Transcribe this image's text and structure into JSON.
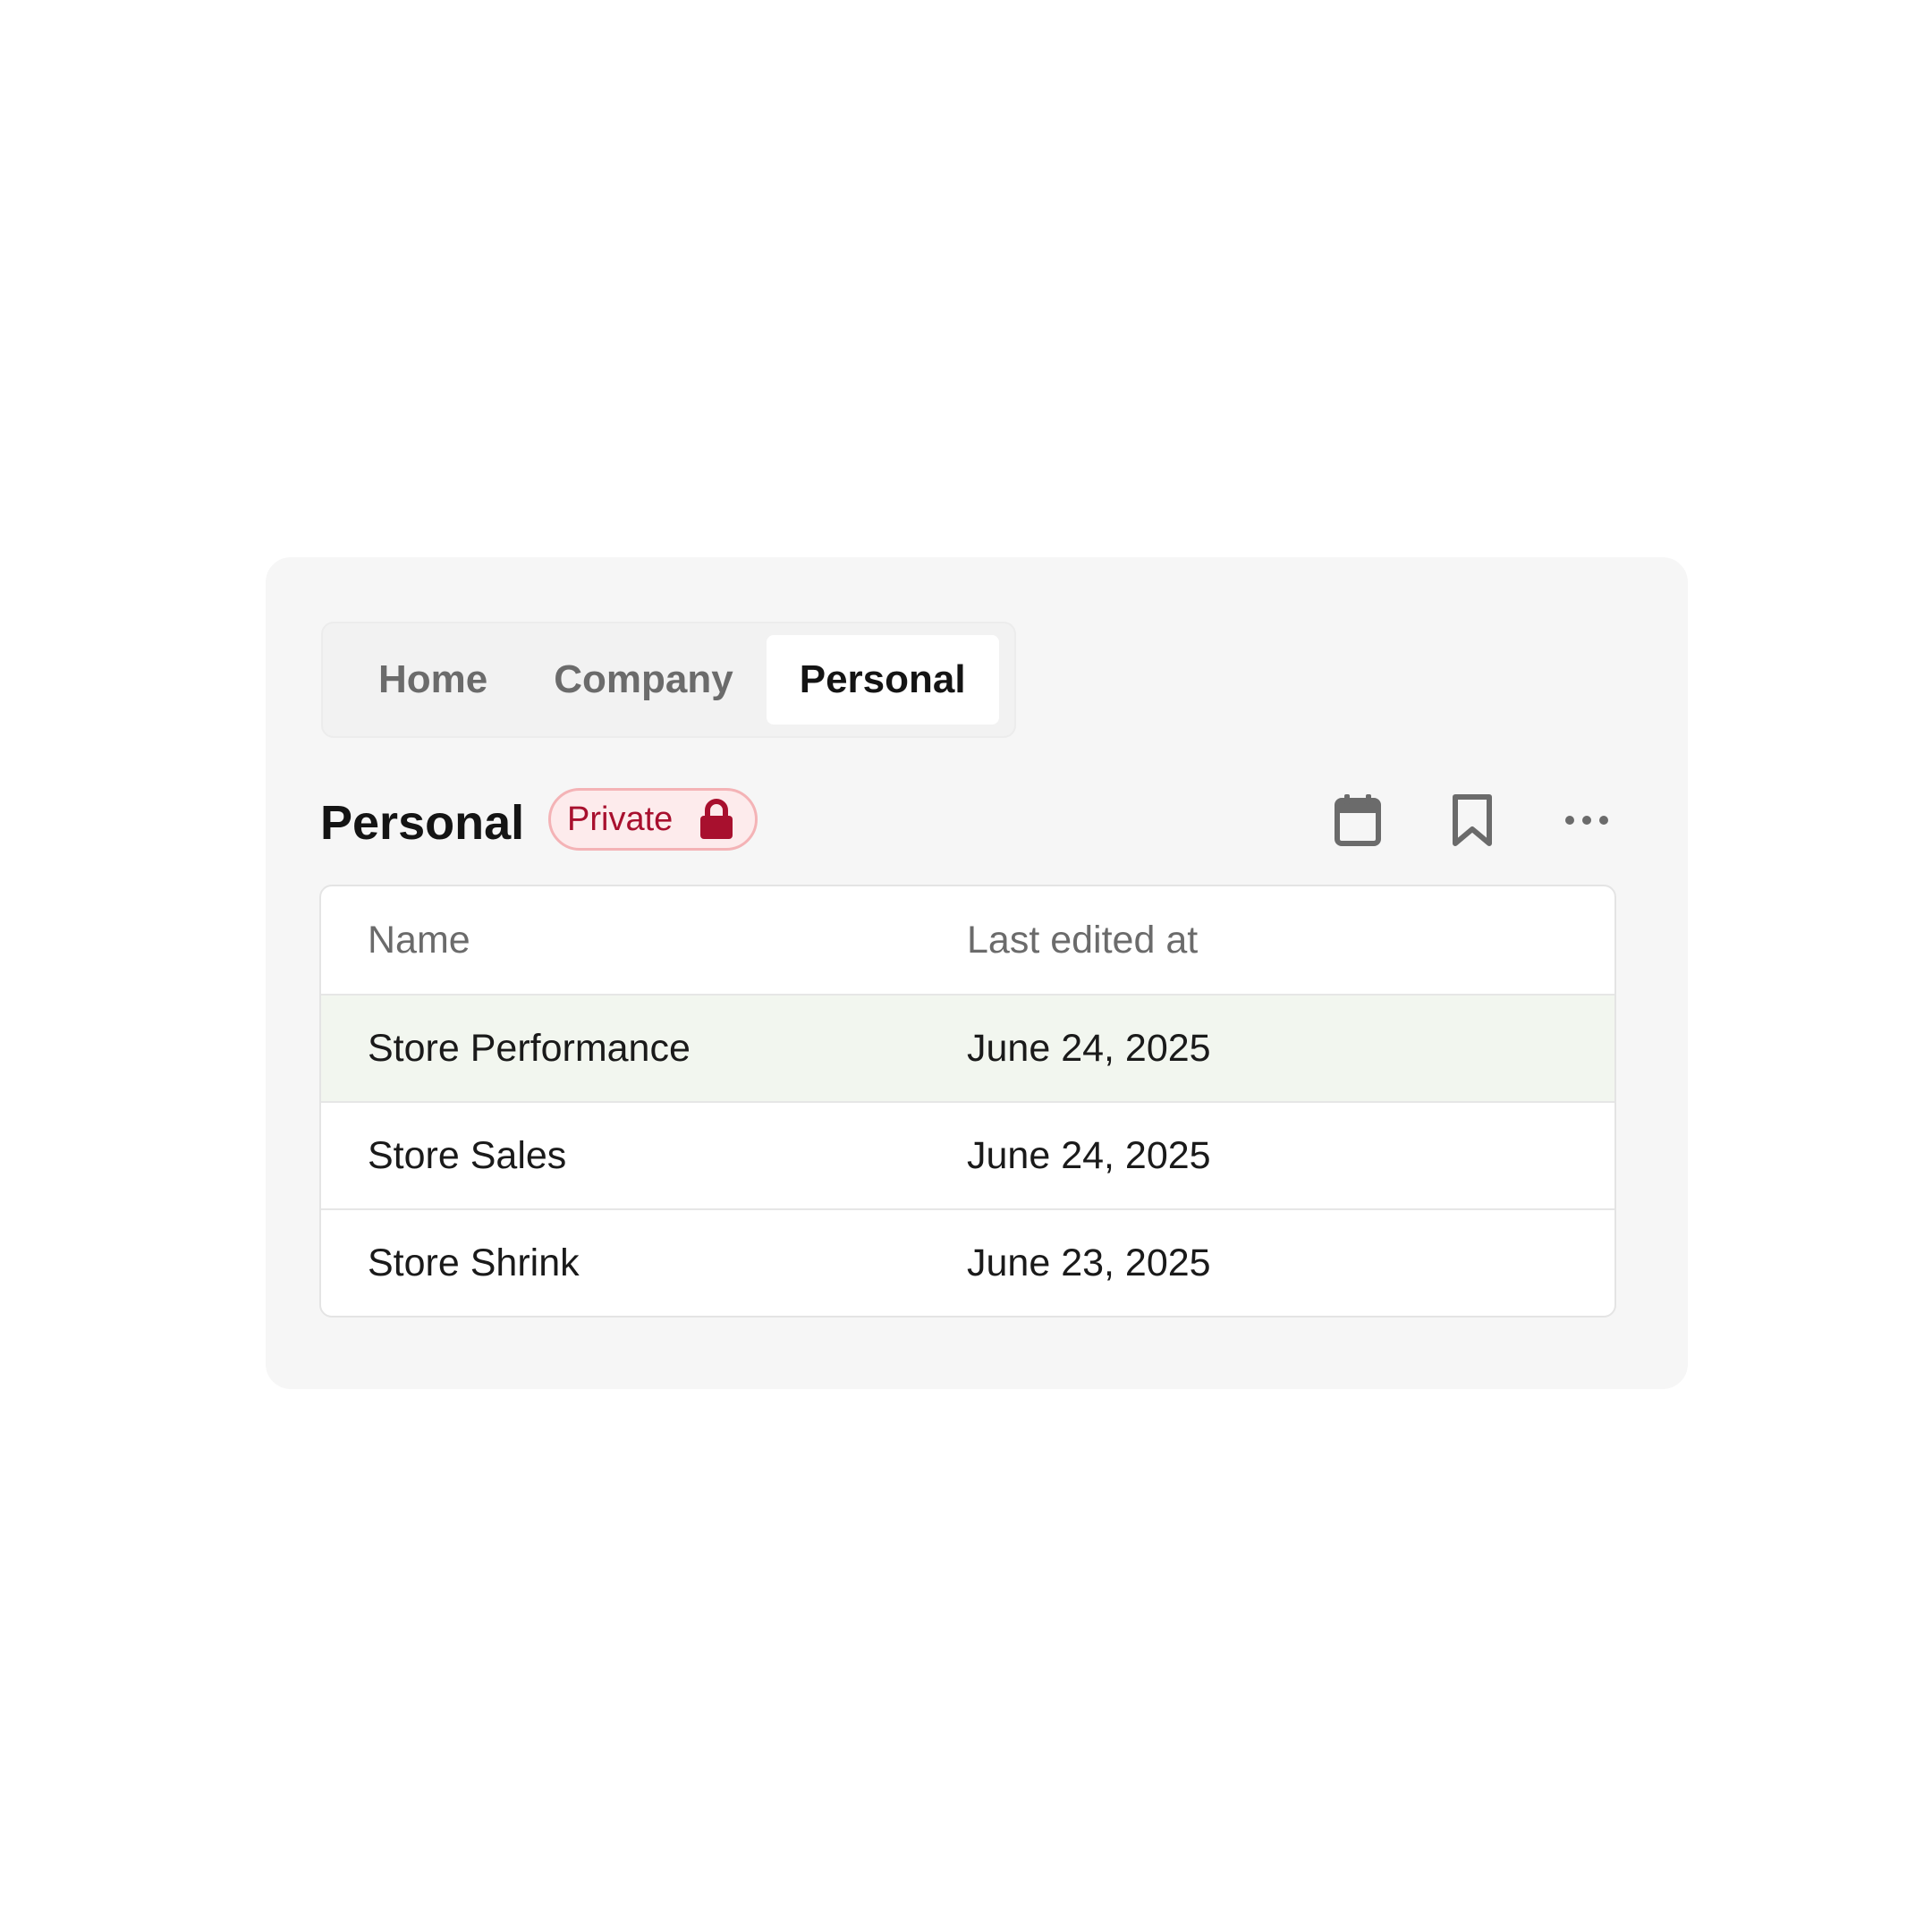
{
  "tabs": [
    {
      "label": "Home",
      "active": false
    },
    {
      "label": "Company",
      "active": false
    },
    {
      "label": "Personal",
      "active": true
    }
  ],
  "page": {
    "title": "Personal",
    "badge_label": "Private",
    "badge_icon": "lock-icon"
  },
  "actions": [
    "calendar-icon",
    "bookmark-icon",
    "more-horizontal-icon"
  ],
  "table": {
    "columns": [
      "Name",
      "Last edited at"
    ],
    "rows": [
      {
        "name": "Store Performance",
        "last_edited": "June 24, 2025",
        "highlighted": true
      },
      {
        "name": "Store Sales",
        "last_edited": "June 24, 2025",
        "highlighted": false
      },
      {
        "name": "Store Shrink",
        "last_edited": "June 23, 2025",
        "highlighted": false
      }
    ]
  },
  "colors": {
    "panel_bg": "#f6f6f6",
    "badge_text": "#a8102e",
    "badge_bg": "#fdebec",
    "badge_border": "#f4b3b6",
    "highlight_row": "#f2f6ef"
  }
}
